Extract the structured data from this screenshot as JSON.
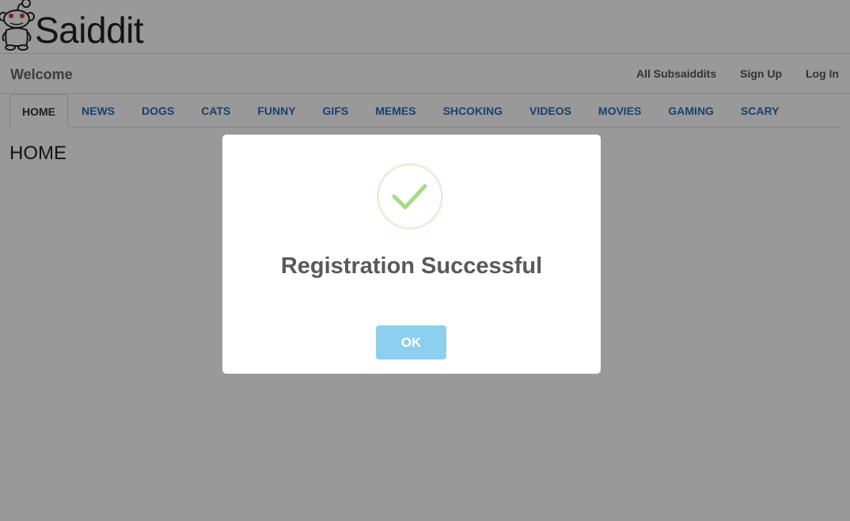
{
  "header": {
    "logo_text": "Saiddit",
    "logo_icon": "alien-mascot-icon"
  },
  "userbar": {
    "welcome": "Welcome",
    "links": [
      "All Subsaiddits",
      "Sign Up",
      "Log In"
    ]
  },
  "tabs": [
    {
      "label": "HOME",
      "active": true
    },
    {
      "label": "NEWS",
      "active": false
    },
    {
      "label": "DOGS",
      "active": false
    },
    {
      "label": "CATS",
      "active": false
    },
    {
      "label": "FUNNY",
      "active": false
    },
    {
      "label": "GIFS",
      "active": false
    },
    {
      "label": "MEMES",
      "active": false
    },
    {
      "label": "SHCOKING",
      "active": false
    },
    {
      "label": "VIDEOS",
      "active": false
    },
    {
      "label": "MOVIES",
      "active": false
    },
    {
      "label": "GAMING",
      "active": false
    },
    {
      "label": "SCARY",
      "active": false
    }
  ],
  "main": {
    "heading": "HOME"
  },
  "modal": {
    "icon": "checkmark-icon",
    "title": "Registration Successful",
    "ok_label": "OK"
  },
  "colors": {
    "link": "#2a6db5",
    "success": "#a5dc86",
    "ok_button": "#8ccfee",
    "overlay": "rgba(0,0,0,0.4)"
  }
}
